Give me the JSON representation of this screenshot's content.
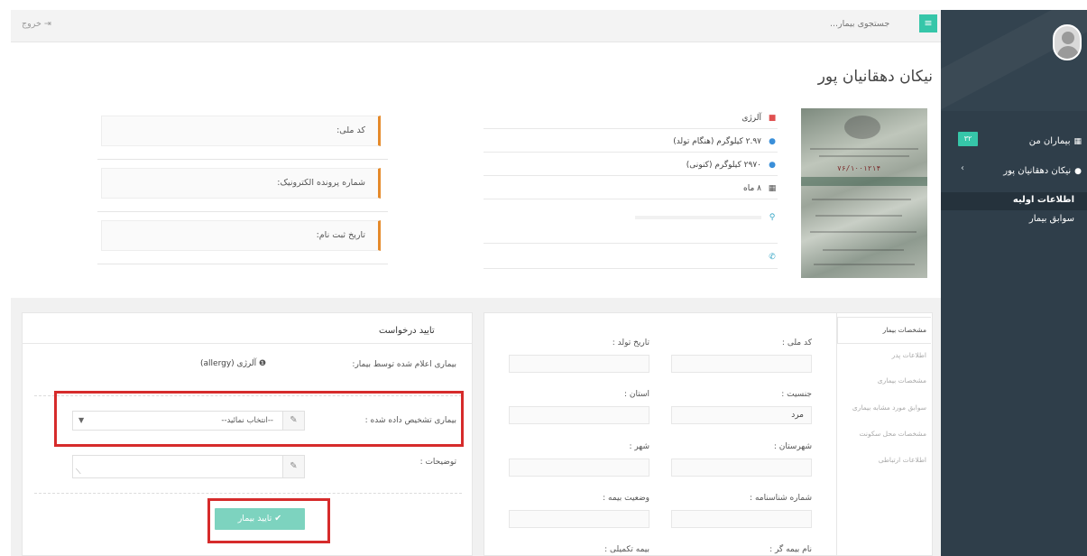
{
  "sidebar": {
    "items": [
      {
        "label": "بیماران من",
        "icon": "grid-icon",
        "badge": "۳۲"
      },
      {
        "label": "نیکان دهقانیان پور",
        "icon": "user-icon",
        "chevron": "‹"
      },
      {
        "label": "اطلاعات اولیه"
      },
      {
        "label": "سوابق بیمار"
      }
    ]
  },
  "topbar": {
    "search_placeholder": "جستجوی بیمار...",
    "logout_label": "خروج"
  },
  "patient": {
    "name": "نیکان دهقانیان پور",
    "info": [
      {
        "icon": "bookmark-icon",
        "text": "آلرژی"
      },
      {
        "icon": "info-circle-icon",
        "text": "۲.۹۷ کیلوگرم (هنگام تولد)"
      },
      {
        "icon": "info-circle-icon",
        "text": "۲۹۷۰ کیلوگرم (کنونی)"
      },
      {
        "icon": "calendar-icon",
        "text": "۸ ماه"
      },
      {
        "icon": "map-marker-icon",
        "text": ""
      },
      {
        "icon": "phone-icon",
        "text": ""
      }
    ],
    "photo_number": "۷۶/۱۰۰۱۲۱۴",
    "callouts": [
      "کد ملی:",
      "شماره پرونده الکترونیک:",
      "تاریخ ثبت نام:"
    ]
  },
  "details": {
    "tabs": [
      "مشخصات بیمار",
      "اطلاعات پدر",
      "مشخصات بیماری",
      "سوابق مورد مشابه بیماری",
      "مشخصات محل سکونت",
      "اطلاعات ارتباطی"
    ],
    "fields": [
      {
        "label": "کد ملی :",
        "value": ""
      },
      {
        "label": "تاریخ تولد :",
        "value": ""
      },
      {
        "label": "جنسیت :",
        "value": "مرد"
      },
      {
        "label": "استان :",
        "value": ""
      },
      {
        "label": "شهرستان :",
        "value": ""
      },
      {
        "label": "شهر :",
        "value": ""
      },
      {
        "label": "شماره شناسنامه :",
        "value": ""
      },
      {
        "label": "وضعیت بیمه :",
        "value": ""
      },
      {
        "label": "نام بیمه گر :",
        "value": ""
      },
      {
        "label": "بیمه تکمیلی :",
        "value": ""
      }
    ]
  },
  "request": {
    "title": "تایید درخواست",
    "declared_label": "بیماری اعلام شده توسط بیمار:",
    "declared_value": "آلرژی (allergy)",
    "diagnosed_label": "بیماری تشخیص داده شده :",
    "select_placeholder": "--انتخاب نمائید--",
    "description_label": "توضیحات :",
    "confirm_label": "تایید بیمار"
  },
  "colors": {
    "sidebar": "#2f3e4a",
    "accent": "#36c6a9",
    "callout_border": "#e58a2a",
    "highlight": "#d62b2b"
  }
}
